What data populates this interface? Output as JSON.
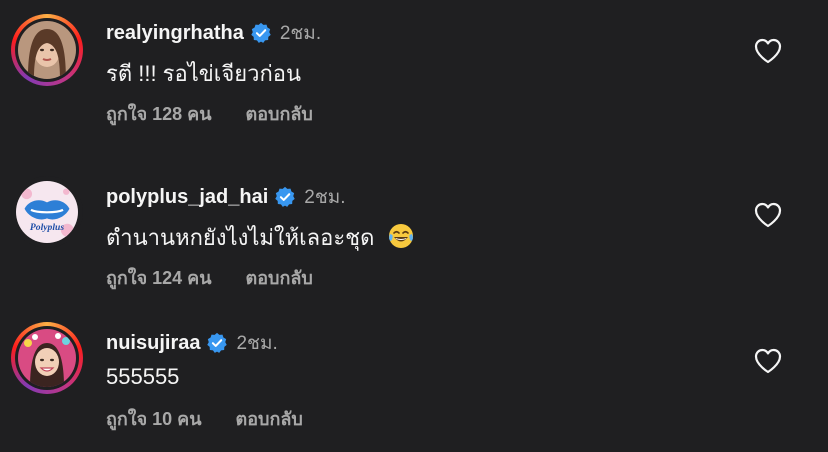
{
  "comments": [
    {
      "username": "realyingrhatha",
      "verified": true,
      "time": "2ชม.",
      "text": "รตี !!! รอไข่เจียวก่อน",
      "likes": "ถูกใจ 128 คน",
      "reply": "ตอบกลับ",
      "story_ring": true
    },
    {
      "username": "polyplus_jad_hai",
      "verified": true,
      "time": "2ชม.",
      "text": "ตำนานหกยังไงไม่ให้เลอะชุด",
      "text_emoji": "face-with-tears-of-joy",
      "likes": "ถูกใจ 124 คน",
      "reply": "ตอบกลับ",
      "story_ring": false,
      "avatar_logo_text": "Polyplus"
    },
    {
      "username": "nuisujiraa",
      "verified": true,
      "time": "2ชม.",
      "text": "555555",
      "likes": "ถูกใจ 10 คน",
      "reply": "ตอบกลับ",
      "story_ring": true
    }
  ],
  "colors": {
    "background": "#1f1f21",
    "verified_blue": "#3897f0",
    "secondary_text": "#a8a8a8"
  }
}
